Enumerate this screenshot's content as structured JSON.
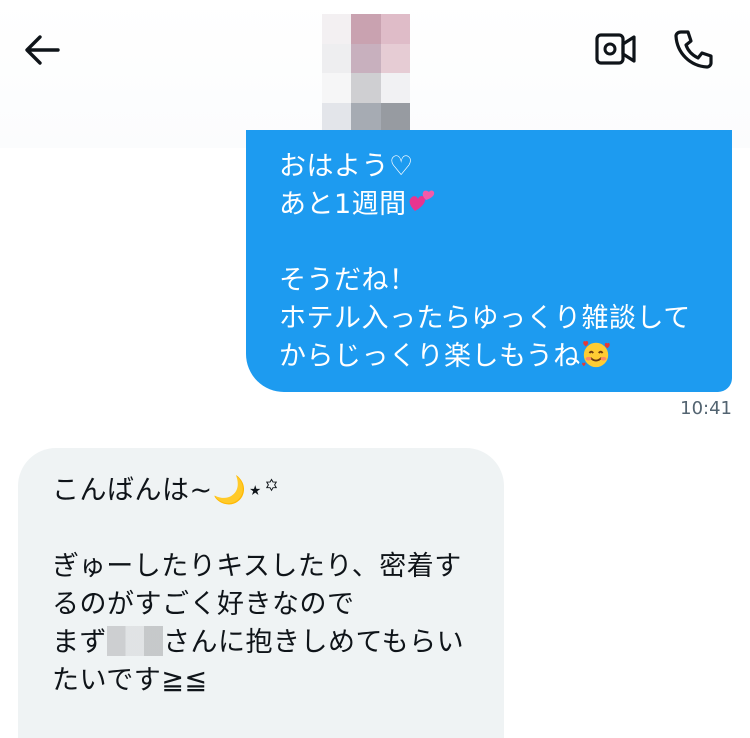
{
  "header": {
    "back_icon": "arrow-left-icon",
    "video_icon": "video-camera-icon",
    "call_icon": "phone-icon",
    "avatar_pixels": [
      "#f3f0f2",
      "#c9a2b0",
      "#dfbcc8",
      "#eeeef0",
      "#c8b0be",
      "#e6ccd4",
      "#f6f6f7",
      "#cfcfd2",
      "#f1f1f3",
      "#e3e5ea",
      "#a6abb3",
      "#979ba1"
    ]
  },
  "messages": {
    "outgoing": {
      "lines": [
        "おはよう♡",
        "あと1週間",
        "",
        "そうだね！",
        "ホテル入ったらゆっくり雑談して",
        "からじっくり楽しもうね"
      ],
      "heart_emoji": "two-hearts-icon",
      "smile_emoji": "smiling-face-with-hearts-icon",
      "timestamp": "10:41"
    },
    "incoming": {
      "line1": "こんばんは~🌙⋆꙳",
      "line2": "",
      "line3": "ぎゅーしたりキスしたり、密着す",
      "line4": "るのがすごく好きなので",
      "line5_before": "まず",
      "line5_after": "さんに抱きしめてもらい",
      "line6": "たいです≧≦"
    }
  },
  "colors": {
    "outgoing_bubble": "#1d9bf0",
    "incoming_bubble": "#eff3f4",
    "timestamp": "#536471"
  }
}
